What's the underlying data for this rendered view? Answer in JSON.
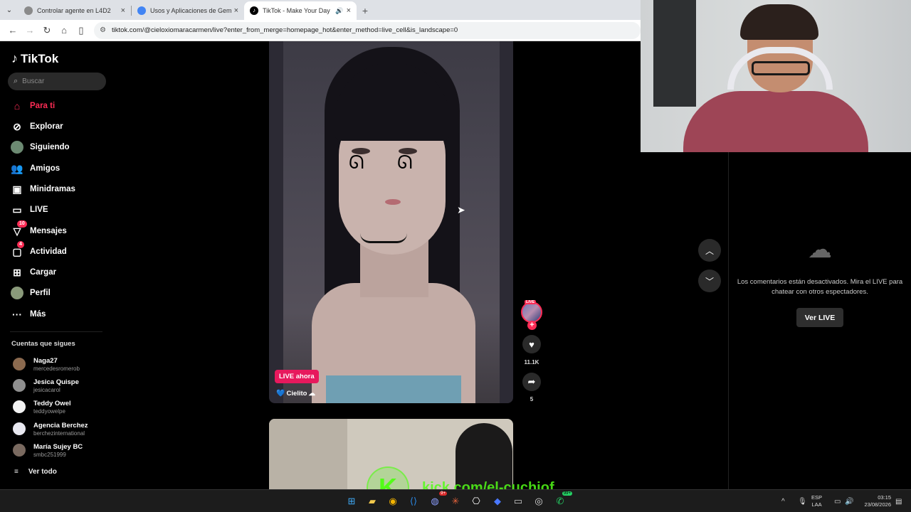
{
  "browser": {
    "tabs": [
      {
        "label": "Controlar agente en L4D2",
        "fav_color": "#8a8a8a"
      },
      {
        "label": "Usos y Aplicaciones de Gemin",
        "fav_color": "#4285f4"
      },
      {
        "label": "TikTok - Make Your Day",
        "fav_color": "#000000"
      }
    ],
    "new_tab": "+",
    "url": "tiktok.com/@cieloxiomaracarmen/live?enter_from_merge=homepage_hot&enter_method=live_cell&is_landscape=0"
  },
  "sidebar": {
    "logo": "TikTok",
    "search_placeholder": "Buscar",
    "nav": [
      {
        "label": "Para ti",
        "icon": "home-icon",
        "active": true
      },
      {
        "label": "Explorar",
        "icon": "compass-icon"
      },
      {
        "label": "Siguiendo",
        "icon": "following-avatar"
      },
      {
        "label": "Amigos",
        "icon": "friends-icon"
      },
      {
        "label": "Minidramas",
        "icon": "film-icon"
      },
      {
        "label": "LIVE",
        "icon": "tv-icon"
      },
      {
        "label": "Mensajes",
        "icon": "send-icon",
        "badge": "10"
      },
      {
        "label": "Actividad",
        "icon": "message-icon",
        "badge": "4"
      },
      {
        "label": "Cargar",
        "icon": "upload-icon"
      },
      {
        "label": "Perfil",
        "icon": "profile-avatar"
      },
      {
        "label": "Más",
        "icon": "more-icon"
      }
    ],
    "following_title": "Cuentas que sigues",
    "accounts": [
      {
        "name": "Naga27",
        "handle": "mercedesromerob",
        "color": "#8b6a4f"
      },
      {
        "name": "Jesica Quispe",
        "handle": "jesicacarol",
        "color": "#8f8f8f"
      },
      {
        "name": "Teddy Owel",
        "handle": "teddyowelpe",
        "color": "#f2f2f2"
      },
      {
        "name": "Agencia Berchez",
        "handle": "berchezinternational",
        "color": "#e8e8f0"
      },
      {
        "name": "María Sujey BC",
        "handle": "smbc251999",
        "color": "#7a6a60"
      }
    ],
    "see_all": "Ver todo"
  },
  "video": {
    "live_badge": "LIVE ahora",
    "creator": "Cielito",
    "creator_prefix": "💙",
    "creator_suffix": "☁"
  },
  "actions": {
    "avatar_live": "LIVE",
    "likes": "11.1K",
    "shares": "5"
  },
  "comments": {
    "disabled_text": "Los comentarios están desactivados. Mira el LIVE para chatear con otros espectadores.",
    "button": "Ver LIVE"
  },
  "watermark": {
    "letter": "K",
    "url": "kick.com/el-cuchiof"
  },
  "taskbar": {
    "lang_line1": "ESP",
    "lang_line2": "LAA",
    "time": "03:15",
    "date": "23/08/2026",
    "discord_badge": "9+",
    "whatsapp_badge": "99+"
  },
  "colors": {
    "tiktok_accent": "#fe2c55",
    "live_pill": "#e7195d",
    "kick_green": "#53fc18"
  }
}
